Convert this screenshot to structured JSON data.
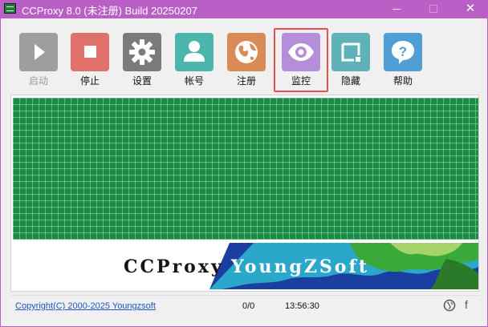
{
  "window": {
    "title": "CCProxy 8.0 (未注册) Build 20250207"
  },
  "toolbar": {
    "buttons": [
      {
        "label": "启动",
        "icon": "play-icon",
        "color": "#9e9e9e",
        "enabled": false
      },
      {
        "label": "停止",
        "icon": "stop-icon",
        "color": "#e0706a",
        "enabled": true
      },
      {
        "label": "设置",
        "icon": "gear-icon",
        "color": "#7b7b7b",
        "enabled": true
      },
      {
        "label": "帐号",
        "icon": "user-icon",
        "color": "#4db6ac",
        "enabled": true
      },
      {
        "label": "注册",
        "icon": "globe-icon",
        "color": "#d98a55",
        "enabled": true
      },
      {
        "label": "监控",
        "icon": "eye-icon",
        "color": "#b48fd9",
        "enabled": true,
        "highlighted": true
      },
      {
        "label": "隐藏",
        "icon": "hide-icon",
        "color": "#5fb3b8",
        "enabled": true
      },
      {
        "label": "帮助",
        "icon": "help-icon",
        "color": "#4f9fd6",
        "enabled": true
      }
    ]
  },
  "monitor": {
    "grid_color": "#1a8a46",
    "grid_line_color": "#96dcaa"
  },
  "banner": {
    "wordmark": "CCProxy",
    "company": "YoungZSoft"
  },
  "status": {
    "copyright": "Copyright(C) 2000-2025 Youngzsoft",
    "traffic": "0/0",
    "time": "13:56:30"
  },
  "colors": {
    "titlebar": "#b95fc6",
    "highlight_border": "#e65050",
    "link": "#1a56c7"
  }
}
